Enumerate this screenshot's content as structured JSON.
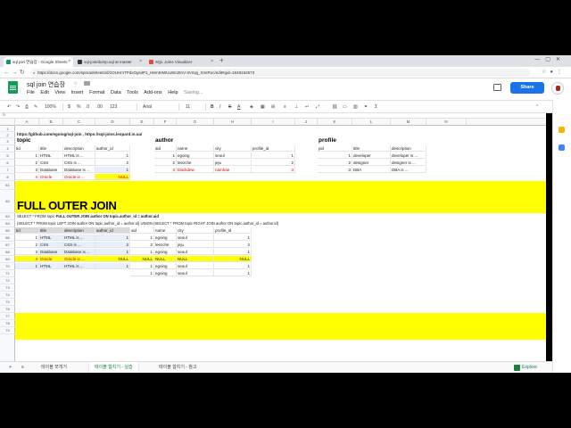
{
  "browser": {
    "tabs": [
      {
        "label": "sql join 연습장 - Google Sheets",
        "favicon_color": "#0f9d58"
      },
      {
        "label": "sql-join/dump.sql at master",
        "favicon_color": "#333333"
      },
      {
        "label": "SQL Joins Visualizer",
        "favicon_color": "#e8453c"
      }
    ],
    "new_tab": "+",
    "url": "https://docs.google.com/spreadsheets/d/1OUHmTPdxOgsiIP1_H8mtHWUuWo2tnV-3Vmpj_XmIRoc/edit#gid=1848162573"
  },
  "sheets": {
    "doc_title": "sql join 연습장",
    "menu": [
      "File",
      "Edit",
      "View",
      "Insert",
      "Format",
      "Data",
      "Tools",
      "Add-ons",
      "Help"
    ],
    "saving": "Saving...",
    "share_label": "Share",
    "toolbar": {
      "zoom": "100%",
      "currency": "$",
      "percent": "%",
      "decimals_dec": ".0",
      "decimals_inc": ".00",
      "number_format": "123",
      "font": "Arial",
      "font_size": "11",
      "bold": "B",
      "italic": "I",
      "strike": "S",
      "text_color": "A"
    },
    "column_headers": [
      "A",
      "B",
      "C",
      "D",
      "E",
      "F",
      "G",
      "H",
      "I",
      "J",
      "K",
      "L",
      "M",
      "N"
    ],
    "row_headers_top": [
      "1",
      "2",
      "3",
      "4",
      "5",
      "6",
      "7",
      "8"
    ],
    "row_headers_bottom": [
      "61",
      "62",
      "63",
      "64",
      "65",
      "66",
      "67",
      "68",
      "69",
      "70",
      "71",
      "72",
      "73",
      "74",
      "75",
      "76",
      "77",
      "78",
      "79"
    ]
  },
  "content": {
    "links": "https://github.com/egoing/sql-join , https://sql-joins.leopard.in.ua/",
    "topic_heading": "topic",
    "author_heading": "author",
    "profile_heading": "profile",
    "topic_cols": [
      "tid",
      "title",
      "description",
      "author_id"
    ],
    "topic_rows": [
      [
        "1",
        "HTML",
        "HTML is ...",
        "1"
      ],
      [
        "2",
        "CSS",
        "CSS is ...",
        "2"
      ],
      [
        "3",
        "Database",
        "Database is ...",
        "1"
      ],
      [
        "4",
        "Oracle",
        "Oracle is ...",
        "NULL"
      ]
    ],
    "author_cols": [
      "aid",
      "name",
      "city",
      "profile_id"
    ],
    "author_rows": [
      [
        "1",
        "egoing",
        "seoul",
        "1"
      ],
      [
        "2",
        "leezche",
        "jeju",
        "2"
      ],
      [
        "3",
        "blackdew",
        "namhae",
        "3"
      ]
    ],
    "profile_cols": [
      "pid",
      "title",
      "description"
    ],
    "profile_rows": [
      [
        "1",
        "developer",
        "developer is ..."
      ],
      [
        "2",
        "designer",
        "designer is ..."
      ],
      [
        "3",
        "DBA",
        "DBA is ..."
      ]
    ],
    "section_title": "FULL OUTER JOIN",
    "sql1_pre": "SELECT * FROM topic ",
    "sql1_bold": "FULL OUTER JOIN author ON topic.author_id = author.aid",
    "sql2": "(SELECT * FROM topic LEFT JOIN author ON topic.author_id = author.id) UNION (SELECT * FROM topic RIGHT JOIN author ON topic.author_id = author.id)",
    "result_cols": [
      "tid",
      "title",
      "description",
      "author_id",
      "aid",
      "name",
      "city",
      "profile_id"
    ],
    "result_rows": [
      [
        "1",
        "HTML",
        "HTML is ...",
        "1",
        "1",
        "egoing",
        "seoul",
        "1"
      ],
      [
        "2",
        "CSS",
        "CSS is ...",
        "2",
        "2",
        "leezche",
        "jeju",
        "2"
      ],
      [
        "3",
        "Database",
        "Database is ...",
        "1",
        "1",
        "egoing",
        "seoul",
        "1"
      ],
      [
        "4",
        "Oracle",
        "Oracle is ...",
        "NULL",
        "NULL",
        "NULL",
        "NULL",
        "NULL"
      ],
      [
        "1",
        "HTML",
        "HTML is ...",
        "1",
        "1",
        "egoing",
        "seoul",
        "1"
      ],
      [
        "",
        "",
        "",
        "",
        "1",
        "egoing",
        "seoul",
        "1"
      ]
    ]
  },
  "sheet_tabs": [
    "테이블 쪼개기",
    "테이블 합치기 - 실습",
    "테이블 합치기 - 참고"
  ],
  "explore_label": "Explore",
  "colors": {
    "accent_green": "#0f9d58",
    "share_blue": "#1a73e8",
    "highlight_yellow": "#ffff00",
    "null_red": "#d00000"
  }
}
